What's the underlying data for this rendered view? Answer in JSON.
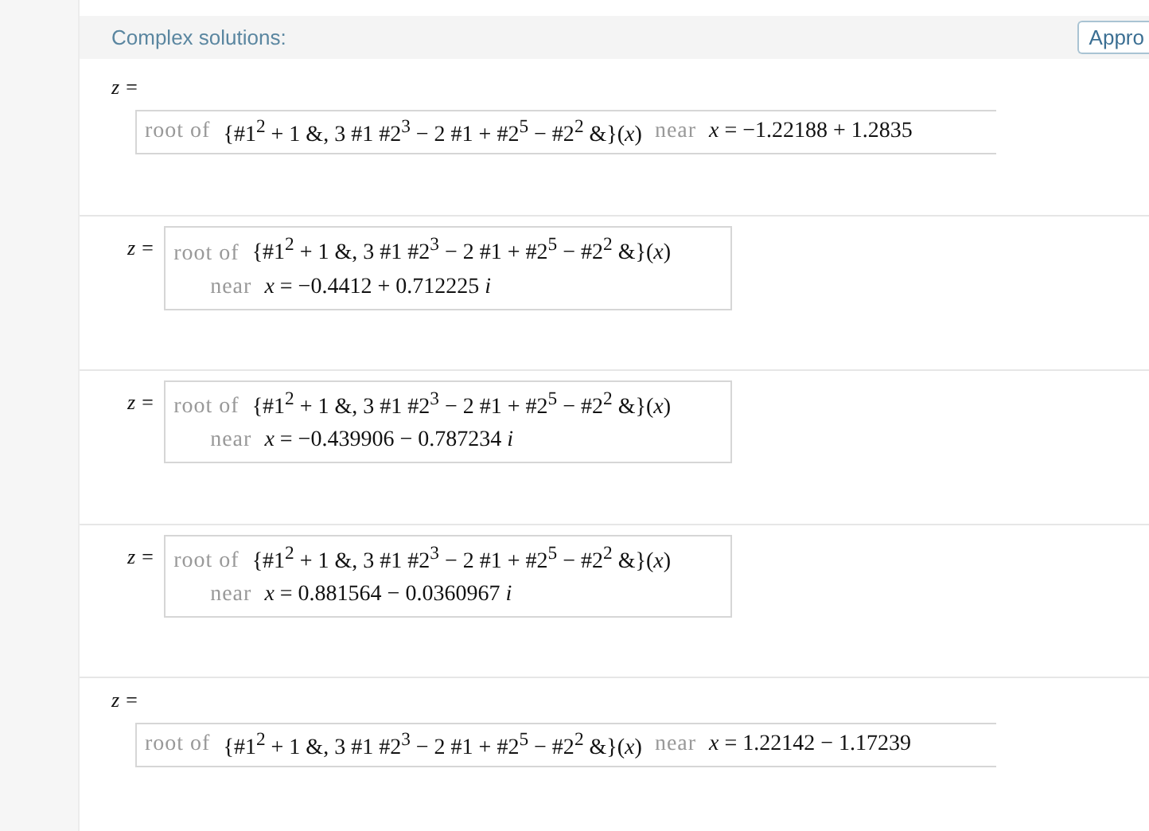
{
  "section": {
    "title": "Complex solutions:",
    "button": "Appro"
  },
  "solutions": [
    {
      "kind": "inline",
      "lhs": "z =",
      "prefix": "root of",
      "expression": "{#1$^{2}$ + 1 &, 3 #1 #2$^{3}$ − 2 #1 + #2$^{5}$ − #2$^{2}$ &}(*x*)",
      "near": "near",
      "value": "*x* = −1.22188 + 1.2835"
    },
    {
      "kind": "stacked",
      "lhs": "z =",
      "prefix": "root of",
      "expression": "{#1$^{2}$ + 1 &, 3 #1 #2$^{3}$ − 2 #1 + #2$^{5}$ − #2$^{2}$ &}(*x*)",
      "near": "near",
      "value": "*x* = −0.4412 + 0.712225 *i*"
    },
    {
      "kind": "stacked",
      "lhs": "z =",
      "prefix": "root of",
      "expression": "{#1$^{2}$ + 1 &, 3 #1 #2$^{3}$ − 2 #1 + #2$^{5}$ − #2$^{2}$ &}(*x*)",
      "near": "near",
      "value": "*x* = −0.439906 − 0.787234 *i*"
    },
    {
      "kind": "stacked",
      "lhs": "z =",
      "prefix": "root of",
      "expression": "{#1$^{2}$ + 1 &, 3 #1 #2$^{3}$ − 2 #1 + #2$^{5}$ − #2$^{2}$ &}(*x*)",
      "near": "near",
      "value": "*x* = 0.881564 − 0.0360967 *i*"
    },
    {
      "kind": "inline",
      "lhs": "z =",
      "prefix": "root of",
      "expression": "{#1$^{2}$ + 1 &, 3 #1 #2$^{3}$ − 2 #1 + #2$^{5}$ − #2$^{2}$ &}(*x*)",
      "near": "near",
      "value": "*x* = 1.22142 − 1.17239"
    }
  ]
}
